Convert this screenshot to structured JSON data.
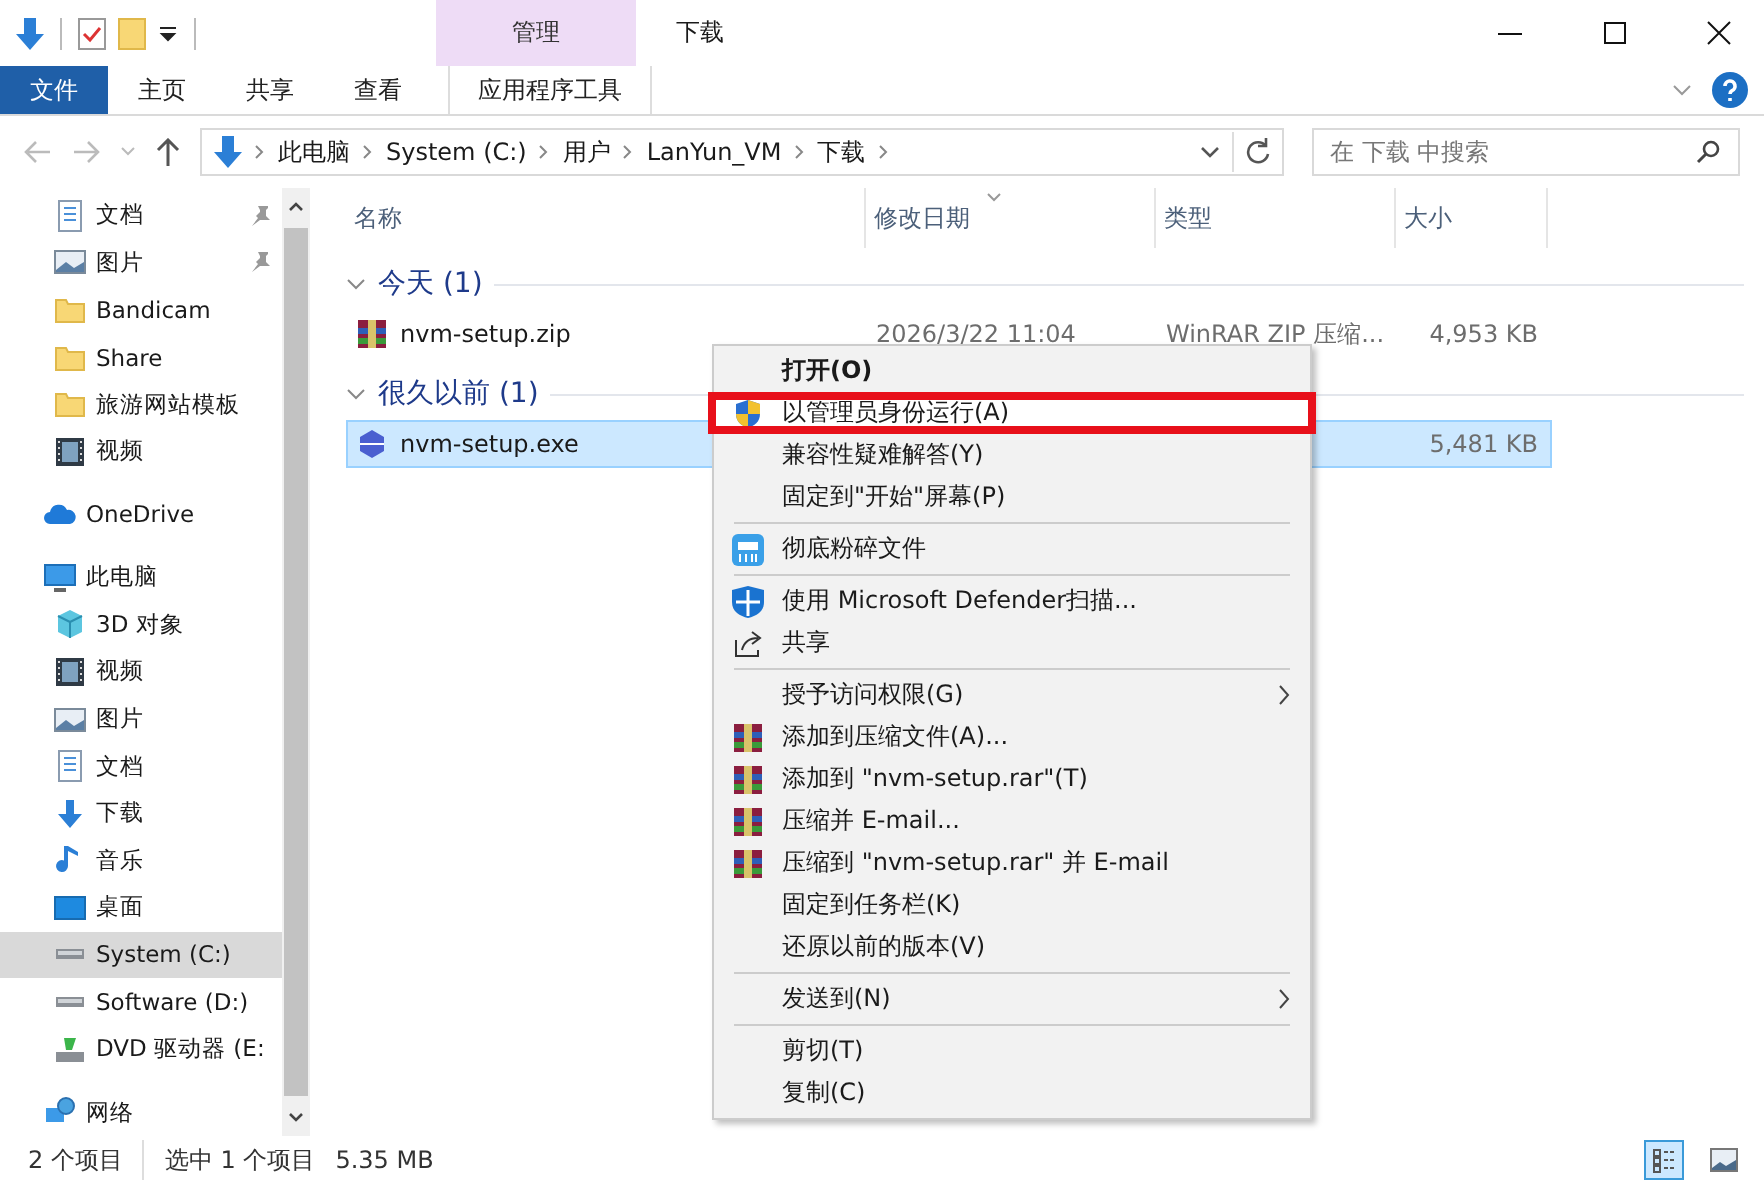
{
  "window": {
    "title": "下载",
    "context_tab": "管理"
  },
  "ribbon": {
    "tabs": [
      {
        "label": "文件",
        "kind": "file"
      },
      {
        "label": "主页",
        "kind": "tab"
      },
      {
        "label": "共享",
        "kind": "tab"
      },
      {
        "label": "查看",
        "kind": "tab"
      },
      {
        "label": "应用程序工具",
        "kind": "context"
      }
    ]
  },
  "address": {
    "path": [
      "此电脑",
      "System (C:)",
      "用户",
      "LanYun_VM",
      "下载"
    ]
  },
  "search": {
    "placeholder": "在 下载 中搜索"
  },
  "sidebar": {
    "items": [
      {
        "label": "文档",
        "kind": "child",
        "pinned": true,
        "selected": false
      },
      {
        "label": "图片",
        "kind": "child",
        "pinned": true,
        "selected": false
      },
      {
        "label": "Bandicam",
        "kind": "child",
        "pinned": false,
        "selected": false
      },
      {
        "label": "Share",
        "kind": "child",
        "pinned": false,
        "selected": false
      },
      {
        "label": "旅游网站模板",
        "kind": "child",
        "pinned": false,
        "selected": false
      },
      {
        "label": "视频",
        "kind": "child",
        "pinned": false,
        "selected": false
      },
      {
        "label": "OneDrive",
        "kind": "root",
        "pinned": false,
        "selected": false
      },
      {
        "label": "此电脑",
        "kind": "root",
        "pinned": false,
        "selected": false
      },
      {
        "label": "3D 对象",
        "kind": "child",
        "pinned": false,
        "selected": false
      },
      {
        "label": "视频",
        "kind": "child",
        "pinned": false,
        "selected": false
      },
      {
        "label": "图片",
        "kind": "child",
        "pinned": false,
        "selected": false
      },
      {
        "label": "文档",
        "kind": "child",
        "pinned": false,
        "selected": false
      },
      {
        "label": "下载",
        "kind": "child",
        "pinned": false,
        "selected": false
      },
      {
        "label": "音乐",
        "kind": "child",
        "pinned": false,
        "selected": false
      },
      {
        "label": "桌面",
        "kind": "child",
        "pinned": false,
        "selected": false
      },
      {
        "label": "System (C:)",
        "kind": "child",
        "pinned": false,
        "selected": true
      },
      {
        "label": "Software (D:)",
        "kind": "child",
        "pinned": false,
        "selected": false
      },
      {
        "label": "DVD 驱动器 (E:",
        "kind": "child",
        "pinned": false,
        "selected": false
      },
      {
        "label": "网络",
        "kind": "root",
        "pinned": false,
        "selected": false
      }
    ]
  },
  "table": {
    "columns": [
      "名称",
      "修改日期",
      "类型",
      "大小"
    ],
    "groups": [
      {
        "label": "今天 (1)",
        "rows": [
          {
            "name": "nvm-setup.zip",
            "date": "2026/3/22 11:04",
            "type": "WinRAR ZIP 压缩...",
            "size": "4,953 KB",
            "selected": false
          }
        ]
      },
      {
        "label": "很久以前 (1)",
        "rows": [
          {
            "name": "nvm-setup.exe",
            "size": "5,481 KB",
            "selected": true
          }
        ]
      }
    ]
  },
  "context_menu": {
    "items": [
      {
        "kind": "item",
        "label": "打开(O)",
        "bold": true,
        "annotated": false
      },
      {
        "kind": "item",
        "label": "以管理员身份运行(A)",
        "bold": false,
        "annotated": true
      },
      {
        "kind": "item",
        "label": "兼容性疑难解答(Y)",
        "bold": false,
        "annotated": false
      },
      {
        "kind": "item",
        "label": "固定到\"开始\"屏幕(P)",
        "bold": false,
        "annotated": false
      },
      {
        "kind": "separator"
      },
      {
        "kind": "item",
        "label": "彻底粉碎文件",
        "bold": false,
        "annotated": false
      },
      {
        "kind": "separator"
      },
      {
        "kind": "item",
        "label": "使用 Microsoft Defender扫描...",
        "bold": false,
        "annotated": false
      },
      {
        "kind": "item",
        "label": "共享",
        "bold": false,
        "annotated": false
      },
      {
        "kind": "separator"
      },
      {
        "kind": "submenu",
        "label": "授予访问权限(G)",
        "bold": false,
        "annotated": false
      },
      {
        "kind": "item",
        "label": "添加到压缩文件(A)...",
        "bold": false,
        "annotated": false
      },
      {
        "kind": "item",
        "label": "添加到 \"nvm-setup.rar\"(T)",
        "bold": false,
        "annotated": false
      },
      {
        "kind": "item",
        "label": "压缩并 E-mail...",
        "bold": false,
        "annotated": false
      },
      {
        "kind": "item",
        "label": "压缩到 \"nvm-setup.rar\" 并 E-mail",
        "bold": false,
        "annotated": false
      },
      {
        "kind": "item",
        "label": "固定到任务栏(K)",
        "bold": false,
        "annotated": false
      },
      {
        "kind": "item",
        "label": "还原以前的版本(V)",
        "bold": false,
        "annotated": false
      },
      {
        "kind": "separator"
      },
      {
        "kind": "submenu",
        "label": "发送到(N)",
        "bold": false,
        "annotated": false
      },
      {
        "kind": "separator"
      },
      {
        "kind": "item",
        "label": "剪切(T)",
        "bold": false,
        "annotated": false
      },
      {
        "kind": "item",
        "label": "复制(C)",
        "bold": false,
        "annotated": false
      }
    ]
  },
  "status_bar": {
    "items": [
      "2 个项目",
      "选中 1 个项目",
      "5.35 MB"
    ]
  }
}
